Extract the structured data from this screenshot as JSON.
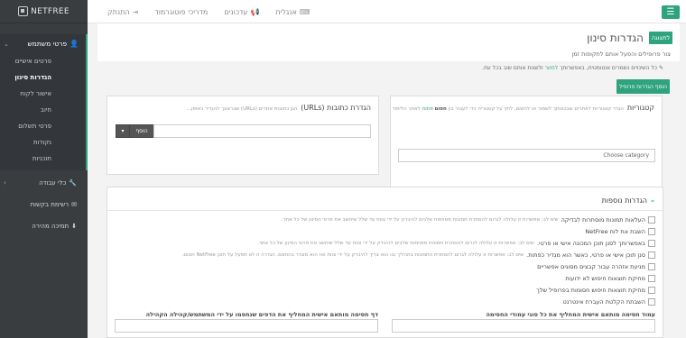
{
  "topbar": {
    "menu_icon": "☰",
    "nav": [
      {
        "label": "אנגלית",
        "icon": "⌨"
      },
      {
        "label": "עדכונים",
        "icon": "📢"
      },
      {
        "label": "מדריכי פוטוגרמוד",
        "icon": ""
      },
      {
        "label": "התנתק",
        "icon": "⇥"
      }
    ]
  },
  "sidebar": {
    "logo_text": "NETFREE",
    "user_section": {
      "label": "פרטי משתמש",
      "icon": "user-icon"
    },
    "user_items": [
      "פרטים אישיים",
      "הגדרות סינון",
      "אישור לקוח",
      "חיוב",
      "פרטי תשלום",
      "נקודות",
      "תוכניות"
    ],
    "active_index": 1,
    "tools": {
      "label": "כלי עבודה",
      "icon": "wrench-icon"
    },
    "requests": {
      "label": "רשימת בקשות",
      "icon": "inbox-icon"
    },
    "download": {
      "label": "תמיכה מהירה",
      "icon": "download-icon"
    }
  },
  "header": {
    "back_label": "לתצוגה",
    "title": "הגדרות סינון",
    "subtitle": "צור פרופילים והפעל אותם לתקופות זמן"
  },
  "info": {
    "prefix": "כל השינויים נשמרים אוטומטית, באפשרותך",
    "link": "לחזור",
    "suffix": "ולשנות אותם שוב בכל עת."
  },
  "add_profile_label": "הוסף הגדרות פרופיל",
  "categories": {
    "title": "קטגוריות",
    "note_prefix": "הגדר קטגוריות לאתרים שבכוונתך לשמור או לחסום, לחץ על קטגוריה כדי לעבור בין",
    "note_allow": "פתוח",
    "note_block": "חסום",
    "note_suffix": "לאתר הלימוד",
    "select_placeholder": "Choose category"
  },
  "urls": {
    "title": "הגדרת כתובות (URLs)",
    "note": "הגן כתובות אתרים (URLs) שברצונך להגדיר באופן...",
    "add_label": "הוסף",
    "dropdown_icon": "▾"
  },
  "more": {
    "title": "הגדרות נוספות",
    "options": [
      {
        "label": "העלאות תמונות מוסתרות לבדיקה",
        "desc": "שים לב: אפשרות זו עלולה לגרום להסתרת תמונות מסוימות שלבים להיבדק על ידי צוות עד שלל שיחשב את פרטי הסינון של כל אתר."
      },
      {
        "label": "השבת את לוח NetFree",
        "desc": ""
      },
      {
        "label": "באפשרותך לסנן תוכן המכונה אישי או פרטי.",
        "desc": "שים לב: אפשרות זו עלולה לגרום להסתרת תמונות מסוימות שלבים להיבדק על ידי צוות עד שלל שיחשב את פרטי הסינון של כל אתר."
      },
      {
        "label": "סנן תוכן אישי או פרטי, כאשר הוא מגדיר כפתות.",
        "desc": "שים לב: אפשרות זו עלולה לגרום להסתרת התמונות בתהליך ובו הוא צריך להיבדק על ידי צוות ואז הוא מוגדר בהתאם. הגדרה זו לא תפעל על תוכן NetFree חסום."
      },
      {
        "label": "מניעת אזהרה עבור קבצים מסוגים אפשריים",
        "desc": ""
      },
      {
        "label": "מחיקת תוצאות חיפוש לא ידועות",
        "desc": ""
      },
      {
        "label": "מחיקת תוצאות חיפוש חסומות בפרופיל שלך",
        "desc": ""
      },
      {
        "label": "השבתת הקלטת העברת אינטרנט",
        "desc": ""
      }
    ],
    "field_right_label": "עמוד חסימה מותאם אישית המחליף את כל סוגי עמודי החסימה",
    "field_left_label": "דף חסימה מותאם אישית המחליף את הדפים שנחסמו על ידי המשתמש/קהילה הקהילה"
  },
  "colors": {
    "accent": "#2fa37e",
    "sidebar": "#3a3d40"
  }
}
